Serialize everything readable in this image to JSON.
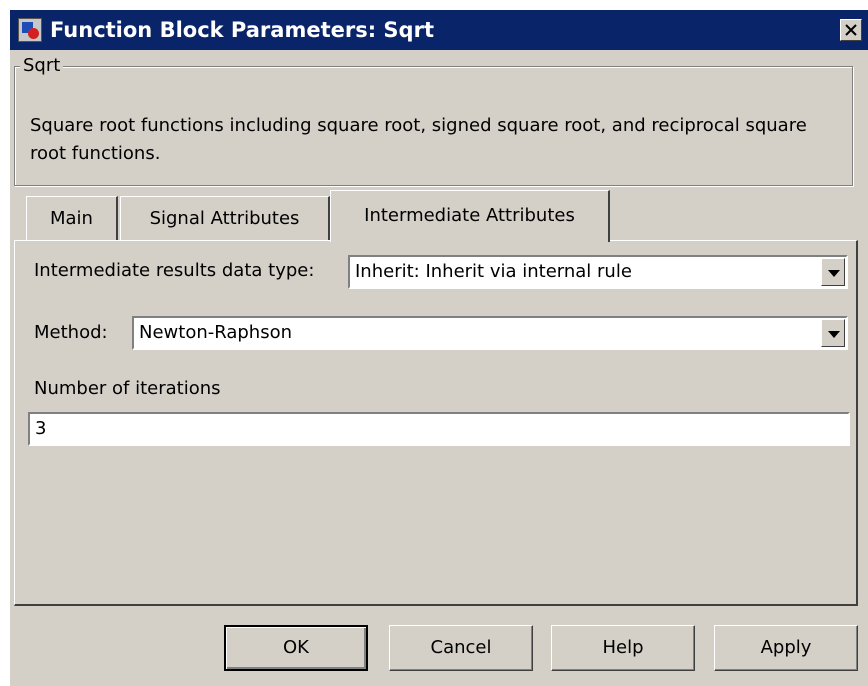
{
  "window": {
    "title": "Function Block Parameters: Sqrt"
  },
  "group": {
    "legend": "Sqrt",
    "description": "Square root functions including square root, signed square root, and reciprocal square root functions."
  },
  "tabs": [
    {
      "label": "Main",
      "active": false
    },
    {
      "label": "Signal Attributes",
      "active": false
    },
    {
      "label": "Intermediate Attributes",
      "active": true
    }
  ],
  "panel": {
    "intermediate_type": {
      "label": "Intermediate results data type:",
      "value": "Inherit: Inherit via internal rule"
    },
    "method": {
      "label": "Method:",
      "value": "Newton-Raphson"
    },
    "iterations": {
      "label": "Number of iterations",
      "value": "3"
    }
  },
  "buttons": {
    "ok": "OK",
    "cancel": "Cancel",
    "help": "Help",
    "apply": "Apply"
  },
  "icons": {
    "app": "simulink-icon",
    "close": "close-icon",
    "dropdown": "chevron-down-icon"
  },
  "colors": {
    "titlebar": "#0a246a",
    "dialog_bg": "#d4d0c8"
  }
}
